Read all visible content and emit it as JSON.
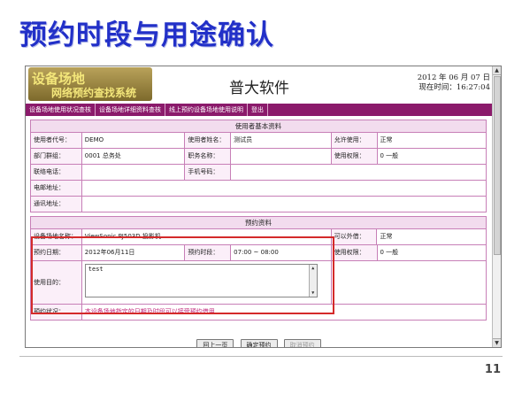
{
  "slide": {
    "title": "预约时段与用途确认",
    "page_number": "11"
  },
  "header": {
    "logo_line1": "设备场地",
    "logo_line2": "网络预约查找系统",
    "brand": "普大软件",
    "date": "2012 年 06 月 07 日",
    "time": "现在时间：16:27:04"
  },
  "nav": {
    "items": [
      "设备场地使用状况查核",
      "设备场地详细资料查核",
      "线上预约设备场地使用说明",
      "登出"
    ]
  },
  "user_section": {
    "heading": "使用者基本资料",
    "code_label": "使用者代号：",
    "code_value": "DEMO",
    "name_label": "使用者姓名：",
    "name_value": "测试员",
    "allow_label": "允许使用：",
    "allow_value": "正常",
    "dept_label": "部门群组：",
    "dept_value": "0001  总务处",
    "title_label": "职务名称：",
    "title_value": "",
    "level_label": "使用权限：",
    "level_value": "0  一般",
    "phone_label": "联络电话：",
    "phone_value": "",
    "mobile_label": "手机号码：",
    "mobile_value": "",
    "email_label": "电邮地址：",
    "email_value": "",
    "address_label": "通讯地址：",
    "address_value": ""
  },
  "reserve_section": {
    "heading": "预约资料",
    "equip_label": "设备场地名称：",
    "equip_value": "ViewSonic PJ503D 投影机",
    "lend_label": "可以外借：",
    "lend_value": "正常",
    "date_label": "预约日期：",
    "date_value": "2012年06月11日",
    "period_label": "预约时段：",
    "period_value": "07:00 ~ 08:00",
    "level_label": "使用权限：",
    "level_value": "0  一般",
    "purpose_label": "使用目的：",
    "purpose_value": "test",
    "status_label": "预约状况：",
    "status_value": "本设备场地指定的日期及时段可以接受预约借用"
  },
  "buttons": {
    "prev": "回上一页",
    "confirm": "确定预约",
    "cancel": "取消预约"
  },
  "colors": {
    "title": "#2230c8",
    "nav": "#8b1a6b",
    "highlight": "#d42a2a",
    "notice": "#c0267a"
  }
}
